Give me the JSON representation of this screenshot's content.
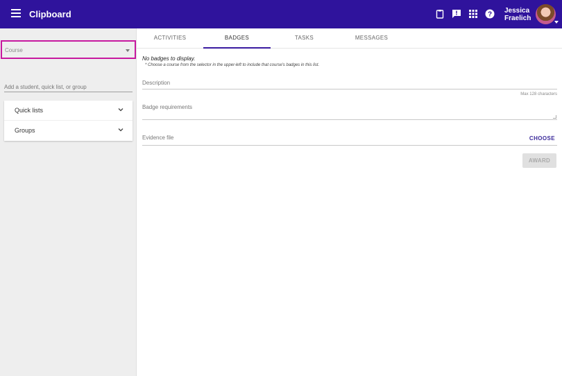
{
  "app": {
    "title": "Clipboard"
  },
  "header": {
    "icons": [
      "clipboard-icon",
      "feedback-icon",
      "apps-grid-icon",
      "help-icon"
    ],
    "user": {
      "first_name": "Jessica",
      "last_name": "Fraelich"
    }
  },
  "sidebar": {
    "course_select": {
      "label": "Course"
    },
    "student_input": {
      "placeholder": "Add a student, quick list, or group"
    },
    "panels": [
      {
        "label": "Quick lists"
      },
      {
        "label": "Groups"
      }
    ]
  },
  "tabs": [
    {
      "label": "ACTIVITIES"
    },
    {
      "label": "BADGES",
      "active": true
    },
    {
      "label": "TASKS"
    },
    {
      "label": "MESSAGES"
    }
  ],
  "main": {
    "no_badges": "No badges to display.",
    "hint": "* Choose a course from the selector in the upper-left to include that course's badges in this list.",
    "description_label": "Description",
    "max_chars": "Max 128 characters",
    "requirements_label": "Badge requirements",
    "evidence_label": "Evidence file",
    "choose_label": "CHOOSE",
    "award_label": "AWARD"
  },
  "colors": {
    "appbar": "#2f139c",
    "highlight": "#c7189f",
    "accent": "#3b2a9a"
  }
}
